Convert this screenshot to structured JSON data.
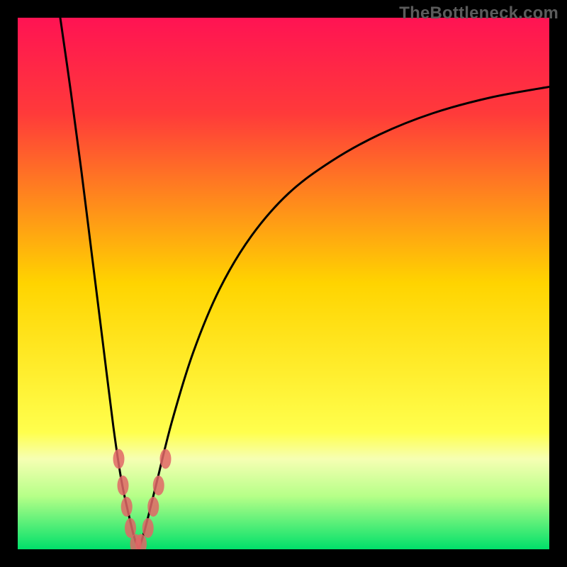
{
  "watermark": "TheBottleneck.com",
  "chart_data": {
    "type": "line",
    "title": "",
    "xlabel": "",
    "ylabel": "",
    "xlim": [
      0,
      100
    ],
    "ylim": [
      0,
      100
    ],
    "gradient_stops": [
      {
        "offset": 0,
        "color": "#ff1353"
      },
      {
        "offset": 18,
        "color": "#ff3a3a"
      },
      {
        "offset": 50,
        "color": "#ffd400"
      },
      {
        "offset": 78,
        "color": "#ffff4d"
      },
      {
        "offset": 83,
        "color": "#f6ffb3"
      },
      {
        "offset": 90,
        "color": "#b6ff88"
      },
      {
        "offset": 100,
        "color": "#00e06a"
      }
    ],
    "series": [
      {
        "name": "left-branch",
        "x": [
          8,
          10,
          12,
          14,
          16,
          18,
          19.5,
          21,
          22,
          22.8
        ],
        "y": [
          100,
          86,
          71,
          55,
          39,
          23,
          13,
          6,
          2,
          0
        ]
      },
      {
        "name": "right-branch",
        "x": [
          22.8,
          24,
          26,
          29,
          33,
          38,
          44,
          51,
          59,
          68,
          78,
          89,
          100
        ],
        "y": [
          0,
          4,
          12,
          24,
          37,
          49,
          59,
          67,
          73,
          78,
          82,
          85,
          87
        ]
      }
    ],
    "markers": {
      "name": "highlight-points",
      "points": [
        {
          "x": 19.0,
          "y": 17
        },
        {
          "x": 19.8,
          "y": 12
        },
        {
          "x": 20.5,
          "y": 8
        },
        {
          "x": 21.2,
          "y": 4
        },
        {
          "x": 22.2,
          "y": 1
        },
        {
          "x": 23.2,
          "y": 1
        },
        {
          "x": 24.5,
          "y": 4
        },
        {
          "x": 25.5,
          "y": 8
        },
        {
          "x": 26.5,
          "y": 12
        },
        {
          "x": 27.8,
          "y": 17
        }
      ],
      "color": "#e06666",
      "rx": 8,
      "ry": 14
    },
    "curve_stroke": "#000000",
    "curve_width": 3
  }
}
